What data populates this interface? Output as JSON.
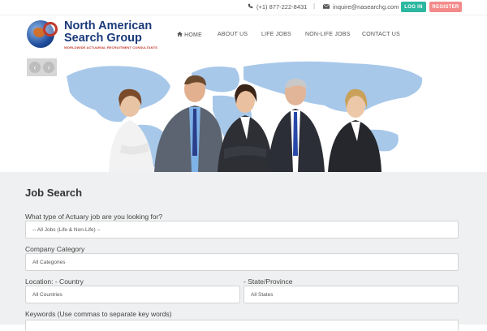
{
  "topbar": {
    "phone": "(+1) 877-222-8431",
    "separator": "|",
    "email": "inquire@nasearchg.com",
    "login_label": "LOG IN",
    "register_label": "REGISTER"
  },
  "logo": {
    "line1": "North American",
    "line2": "Search Group",
    "tagline": "WORLDWIDE ACTUARIAL RECRUITMENT CONSULTANTS"
  },
  "nav": {
    "home": "HOME",
    "about": "ABOUT US",
    "life": "LIFE JOBS",
    "nonlife": "NON-LIFE JOBS",
    "contact": "CONTACT US"
  },
  "slider": {
    "prev": "‹",
    "next": "›"
  },
  "job_search": {
    "title": "Job Search",
    "type_label": "What type of Actuary job are you looking for?",
    "type_value": "-- All Jobs (Life & Non-Life) --",
    "category_label": "Company Category",
    "category_value": "All Categories",
    "country_label": "Location: - Country",
    "country_value": "All Countries",
    "state_label": "- State/Province",
    "state_value": "All States",
    "keywords_label": "Keywords (Use commas to separate key words)"
  },
  "colors": {
    "login": "#2bb7a0",
    "register": "#f38a8a",
    "brand": "#1b3a7a",
    "map": "#9fc3e8",
    "section_bg": "#eef0f1"
  }
}
